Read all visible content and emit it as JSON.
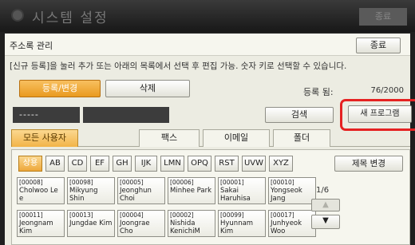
{
  "window": {
    "title": "시스템 설정",
    "close_label": "종료",
    "icon": "gear-icon"
  },
  "header": {
    "label": "주소록 관리",
    "end_label": "종료"
  },
  "instruction": "[신규 등록]을 눌러 추가 또는 아래의 목록에서 선택 후 편집 가능. 숫자 키로 선택할 수 있습니다.",
  "actions": {
    "register_label": "등록/변경",
    "delete_label": "삭제",
    "registered_label": "등록 됨:",
    "registered_value": "76/2000"
  },
  "search": {
    "field_value": "-----",
    "search_label": "검색",
    "new_program_label": "새 프로그램"
  },
  "tabs": [
    {
      "label": "모든 사용자",
      "active": true
    },
    {
      "label": "팩스",
      "active": false
    },
    {
      "label": "이메일",
      "active": false
    },
    {
      "label": "폴더",
      "active": false
    }
  ],
  "index_buttons": [
    {
      "label": "상용",
      "active": true
    },
    {
      "label": "AB",
      "active": false
    },
    {
      "label": "CD",
      "active": false
    },
    {
      "label": "EF",
      "active": false
    },
    {
      "label": "GH",
      "active": false
    },
    {
      "label": "IJK",
      "active": false
    },
    {
      "label": "LMN",
      "active": false
    },
    {
      "label": "OPQ",
      "active": false
    },
    {
      "label": "RST",
      "active": false
    },
    {
      "label": "UVW",
      "active": false
    },
    {
      "label": "XYZ",
      "active": false
    }
  ],
  "title_change_label": "제목 변경",
  "entries": [
    {
      "num": "[00008]",
      "name": "Cholwoo Le e"
    },
    {
      "num": "[00098]",
      "name": "Mikyung Shin"
    },
    {
      "num": "[00005]",
      "name": "Jeonghun Choi"
    },
    {
      "num": "[00006]",
      "name": "Minhee Park"
    },
    {
      "num": "[00001]",
      "name": "Sakai Haruhisa"
    },
    {
      "num": "[00010]",
      "name": "Yongseok Jang"
    },
    {
      "num": "[00011]",
      "name": "Jeongnam Kim"
    },
    {
      "num": "[00013]",
      "name": "Jungdae Kim"
    },
    {
      "num": "[00004]",
      "name": "Joongrae Cho"
    },
    {
      "num": "[00002]",
      "name": "Nishida KenichiM"
    },
    {
      "num": "[00099]",
      "name": "Hyunnam Kim"
    },
    {
      "num": "[00017]",
      "name": "Junhyeok Woo"
    }
  ],
  "page": {
    "indicator": "1/6",
    "up_label": "▲",
    "down_label": "▼"
  },
  "colors": {
    "accent": "#f2b448",
    "highlight": "#e52222",
    "panel": "#ecece2"
  }
}
